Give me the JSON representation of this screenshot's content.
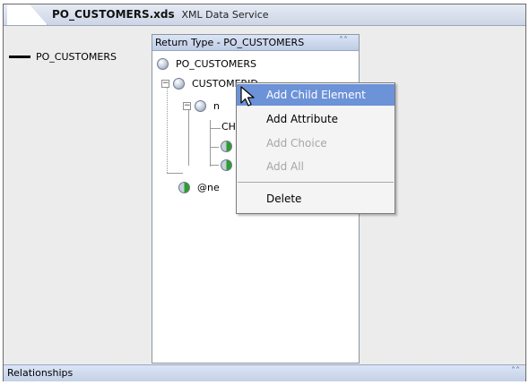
{
  "tab": {
    "file_name": "PO_CUSTOMERS.xds",
    "description": "XML Data Service"
  },
  "side_entry": {
    "label": "PO_CUSTOMERS"
  },
  "panel": {
    "title": "Return Type - PO_CUSTOMERS",
    "collapse_icon": "double-chevron-up-icon",
    "root": "PO_CUSTOMERS",
    "nodes": [
      "CUSTOMERID",
      "n",
      "CH",
      "@ne"
    ]
  },
  "context_menu": {
    "items": [
      {
        "label": "Add Child Element",
        "state": "highlighted"
      },
      {
        "label": "Add Attribute",
        "state": "enabled"
      },
      {
        "label": "Add Choice",
        "state": "disabled"
      },
      {
        "label": "Add All",
        "state": "disabled"
      },
      {
        "label": "Delete",
        "state": "enabled"
      }
    ]
  },
  "relationships": {
    "label": "Relationships",
    "icon": "double-chevron-up-icon"
  },
  "colors": {
    "menu_highlight": "#6c92d8",
    "panel_header": "#c4d0e6",
    "attribute_icon": "#2d9d2d"
  }
}
